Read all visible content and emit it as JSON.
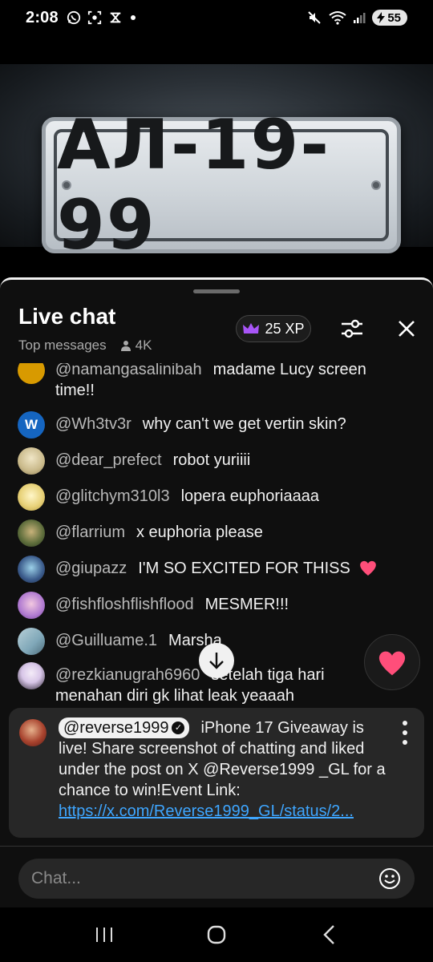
{
  "status_bar": {
    "time": "2:08",
    "icons_left": [
      "whatsapp-icon",
      "screenshot-icon",
      "sync-icon",
      "dot-icon"
    ],
    "icons_right": [
      "mute-icon",
      "wifi-icon",
      "signal-icon"
    ],
    "battery": "55"
  },
  "video": {
    "plate_text": "АЛ-19-99"
  },
  "chat": {
    "title": "Live chat",
    "mode": "Top messages",
    "viewers": "4K",
    "xp_label": "25 XP",
    "messages": [
      {
        "author": "@namangasalinibah",
        "text": "madame Lucy screen time!!",
        "avatar_color": "#d89a00",
        "avatar_letter": ""
      },
      {
        "author": "@Wh3tv3r",
        "text": "why can't we get vertin skin?",
        "avatar_color": "#1565c0",
        "avatar_letter": "W"
      },
      {
        "author": "@dear_prefect",
        "text": "robot yuriiii",
        "avatar_color": "#c9b98a",
        "avatar_letter": ""
      },
      {
        "author": "@glitchym310l3",
        "text": "lopera euphoriaaaa",
        "avatar_color": "#e8d27a",
        "avatar_letter": ""
      },
      {
        "author": "@flarrium",
        "text": "x euphoria please",
        "avatar_color": "#5b6b3a",
        "avatar_letter": ""
      },
      {
        "author": "@giupazz",
        "text": "I'M SO EXCITED FOR THISS",
        "avatar_color": "#3a5a8a",
        "avatar_letter": ""
      },
      {
        "author": "@fishfloshflishflood",
        "text": "MESMER!!!",
        "avatar_color": "#b07ad0",
        "avatar_letter": ""
      },
      {
        "author": "@Guilluame.1",
        "text": "Marsha",
        "avatar_color": "#7fa7b8",
        "avatar_letter": ""
      },
      {
        "author": "@rezkianugrah6960",
        "text": "setelah tiga hari menahan diri gk lihat leak yeaaah",
        "avatar_color": "#d8c6e8",
        "avatar_letter": ""
      }
    ],
    "pinned": {
      "author": "@reverse1999",
      "text": "iPhone 17 Giveaway is live! Share screenshot of chatting and liked under the post on X @Reverse1999 _GL for a chance to win!Event Link: ",
      "link": "https://x.com/Reverse1999_GL/status/2..."
    },
    "input_placeholder": "Chat..."
  },
  "colors": {
    "panel_bg": "#0f0f0f",
    "pinned_bg": "#272727",
    "link": "#3ea6ff",
    "heart": "#ff4e7a",
    "crown": "#a855f7"
  }
}
